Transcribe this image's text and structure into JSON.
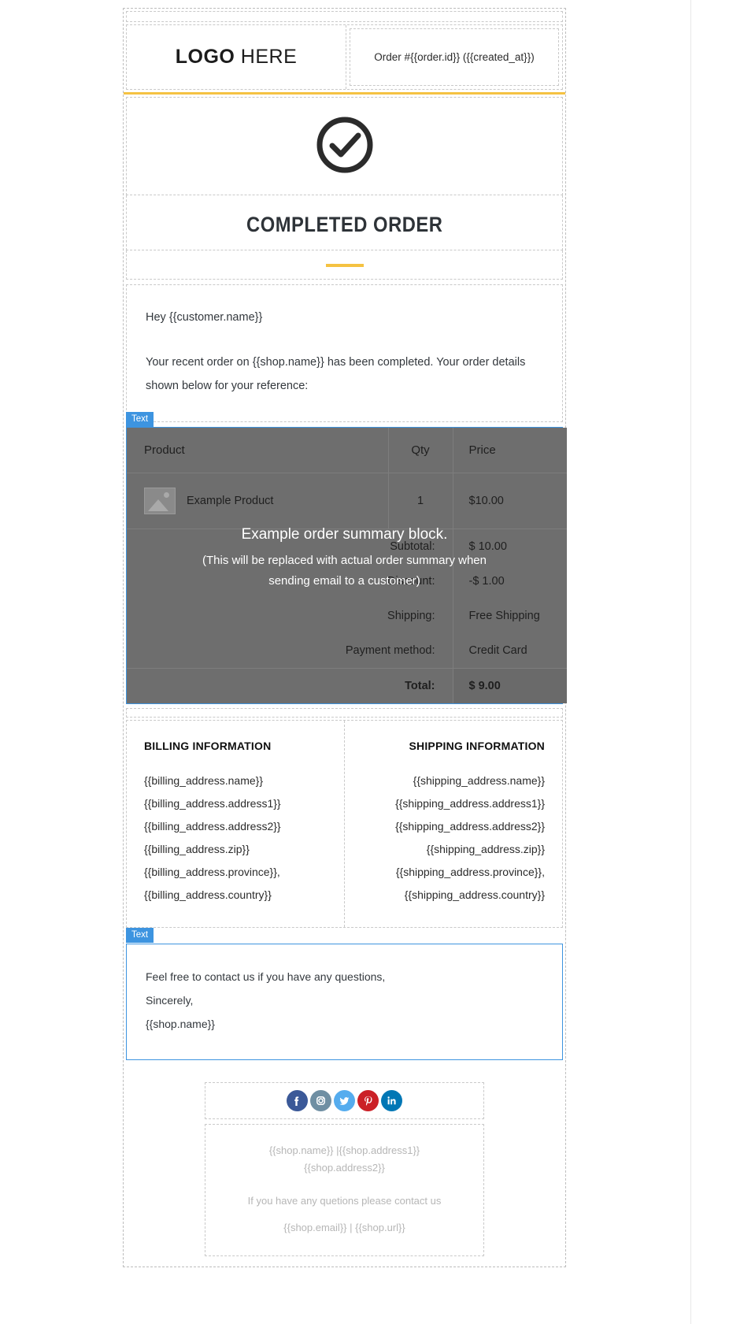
{
  "editor": {
    "block_tag_label": "Text"
  },
  "header": {
    "logo_bold": "LOGO",
    "logo_light": " HERE",
    "order_meta": "Order #{{order.id}} ({{created_at}})",
    "accent_color": "#f5c242"
  },
  "hero": {
    "icon": "check-circle-icon",
    "title": "COMPLETED ORDER"
  },
  "intro": {
    "greeting": "Hey  {{customer.name}}",
    "body": "Your recent order on {{shop.name}}  has been completed. Your order details shown below for your reference:"
  },
  "order_table": {
    "columns": [
      "Product",
      "Qty",
      "Price"
    ],
    "rows": [
      {
        "image": "image-placeholder-icon",
        "product": "Example Product",
        "qty": "1",
        "price": "$10.00"
      }
    ],
    "summary": [
      {
        "label": "Subtotal:",
        "value": "$ 10.00"
      },
      {
        "label": "Discount:",
        "value": "-$ 1.00"
      },
      {
        "label": "Shipping:",
        "value": "Free Shipping"
      },
      {
        "label": "Payment method:",
        "value": "Credit Card"
      }
    ],
    "total": {
      "label": "Total:",
      "value": "$ 9.00"
    },
    "overlay_main": "Example order summary block.",
    "overlay_sub_line1": "(This will be replaced with actual order summary when",
    "overlay_sub_line2": "sending email to a customer)"
  },
  "billing": {
    "title": "BILLING INFORMATION",
    "lines": [
      "{{billing_address.name}}",
      "{{billing_address.address1}}",
      "{{billing_address.address2}}",
      "{{billing_address.zip}}",
      "{{billing_address.province}},",
      "{{billing_address.country}}"
    ]
  },
  "shipping": {
    "title": "SHIPPING INFORMATION",
    "lines": [
      "{{shipping_address.name}}",
      "{{shipping_address.address1}}",
      "{{shipping_address.address2}}",
      "{{shipping_address.zip}}",
      "{{shipping_address.province}},",
      "{{shipping_address.country}}"
    ]
  },
  "closing": {
    "line1": "Feel free to contact us if you have any questions,",
    "line2": "Sincerely,",
    "line3": "{{shop.name}}"
  },
  "footer": {
    "social": [
      {
        "name": "facebook-icon",
        "color": "#3b5998",
        "glyph": "f"
      },
      {
        "name": "instagram-icon",
        "color": "#6f8fa3",
        "glyph": "ig"
      },
      {
        "name": "twitter-icon",
        "color": "#55acee",
        "glyph": "t"
      },
      {
        "name": "pinterest-icon",
        "color": "#cb2027",
        "glyph": "p"
      },
      {
        "name": "linkedin-icon",
        "color": "#0077b5",
        "glyph": "in"
      }
    ],
    "line1": "{{shop.name}} |{{shop.address1}}",
    "line2": "{{shop.address2}}",
    "line3": "If you have any quetions please contact us",
    "line4": "{{shop.email}} | {{shop.url}}"
  }
}
